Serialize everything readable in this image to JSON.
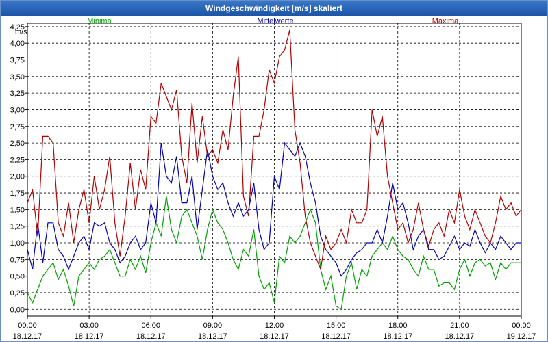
{
  "window": {
    "title": "Windgeschwindigkeit [m/s] skaliert"
  },
  "chart_data": {
    "type": "line",
    "title": "Windgeschwindigkeit [m/s] skaliert",
    "ylabel": "m/s",
    "ylim": [
      -0.1,
      4.3
    ],
    "yticks": [
      "0,00",
      "0,25",
      "0,50",
      "0,75",
      "1,00",
      "1,25",
      "1,50",
      "1,75",
      "2,00",
      "2,25",
      "2,50",
      "2,75",
      "3,00",
      "3,25",
      "3,50",
      "3,75",
      "4,00",
      "4,25"
    ],
    "xlim": [
      0,
      24
    ],
    "xticks": [
      {
        "time": "00:00",
        "date": "18.12.17"
      },
      {
        "time": "03:00",
        "date": "18.12.17"
      },
      {
        "time": "06:00",
        "date": "18.12.17"
      },
      {
        "time": "09:00",
        "date": "18.12.17"
      },
      {
        "time": "12:00",
        "date": "18.12.17"
      },
      {
        "time": "15:00",
        "date": "18.12.17"
      },
      {
        "time": "18:00",
        "date": "18.12.17"
      },
      {
        "time": "21:00",
        "date": "18.12.17"
      },
      {
        "time": "00:00",
        "date": "19.12.17"
      }
    ],
    "grid": true,
    "legend_position": "top",
    "series": [
      {
        "name": "Minima",
        "color": "#00a000",
        "x": [
          0,
          0.25,
          0.5,
          0.75,
          1,
          1.25,
          1.5,
          1.75,
          2,
          2.25,
          2.5,
          2.75,
          3,
          3.25,
          3.5,
          3.75,
          4,
          4.25,
          4.5,
          4.75,
          5,
          5.25,
          5.5,
          5.75,
          6,
          6.25,
          6.5,
          6.75,
          7,
          7.25,
          7.5,
          7.75,
          8,
          8.25,
          8.5,
          8.75,
          9,
          9.25,
          9.5,
          9.75,
          10,
          10.25,
          10.5,
          10.75,
          11,
          11.25,
          11.5,
          11.75,
          12,
          12.25,
          12.5,
          12.75,
          13,
          13.25,
          13.5,
          13.75,
          14,
          14.25,
          14.5,
          14.75,
          15,
          15.25,
          15.5,
          15.75,
          16,
          16.25,
          16.5,
          16.75,
          17,
          17.25,
          17.5,
          17.75,
          18,
          18.25,
          18.5,
          18.75,
          19,
          19.25,
          19.5,
          19.75,
          20,
          20.25,
          20.5,
          20.75,
          21,
          21.25,
          21.5,
          21.75,
          22,
          22.25,
          22.5,
          22.75,
          23,
          23.25,
          23.5,
          23.75,
          24
        ],
        "values": [
          0.25,
          0.1,
          0.3,
          0.5,
          0.6,
          0.7,
          0.45,
          0.6,
          0.35,
          0.05,
          0.5,
          0.6,
          0.7,
          0.6,
          0.75,
          0.8,
          0.9,
          0.7,
          0.5,
          0.5,
          0.75,
          0.6,
          0.8,
          0.55,
          1.0,
          1.3,
          1.1,
          1.7,
          1.2,
          1.0,
          1.4,
          1.5,
          1.3,
          1.1,
          0.75,
          1.2,
          1.5,
          1.3,
          1.2,
          1.0,
          0.75,
          0.6,
          0.9,
          0.8,
          1.2,
          0.5,
          0.3,
          0.4,
          0.1,
          0.8,
          0.7,
          1.1,
          1.0,
          1.1,
          1.3,
          1.5,
          1.3,
          0.6,
          0.3,
          0.5,
          0.05,
          0.0,
          0.5,
          0.7,
          0.3,
          0.6,
          0.5,
          0.8,
          0.9,
          1.0,
          0.9,
          1.1,
          0.9,
          0.8,
          0.75,
          0.6,
          0.5,
          0.8,
          0.6,
          0.6,
          0.35,
          0.4,
          0.4,
          0.3,
          0.6,
          0.75,
          0.5,
          0.7,
          0.75,
          0.65,
          0.7,
          0.45,
          0.7,
          0.6,
          0.7,
          0.7,
          0.7
        ]
      },
      {
        "name": "Mittelwerte",
        "color": "#0000b0",
        "x": [
          0,
          0.25,
          0.5,
          0.75,
          1,
          1.25,
          1.5,
          1.75,
          2,
          2.25,
          2.5,
          2.75,
          3,
          3.25,
          3.5,
          3.75,
          4,
          4.25,
          4.5,
          4.75,
          5,
          5.25,
          5.5,
          5.75,
          6,
          6.25,
          6.5,
          6.75,
          7,
          7.25,
          7.5,
          7.75,
          8,
          8.25,
          8.5,
          8.75,
          9,
          9.25,
          9.5,
          9.75,
          10,
          10.25,
          10.5,
          10.75,
          11,
          11.25,
          11.5,
          11.75,
          12,
          12.25,
          12.5,
          12.75,
          13,
          13.25,
          13.5,
          13.75,
          14,
          14.25,
          14.5,
          14.75,
          15,
          15.25,
          15.5,
          15.75,
          16,
          16.25,
          16.5,
          16.75,
          17,
          17.25,
          17.5,
          17.75,
          18,
          18.25,
          18.5,
          18.75,
          19,
          19.25,
          19.5,
          19.75,
          20,
          20.25,
          20.5,
          20.75,
          21,
          21.25,
          21.5,
          21.75,
          22,
          22.25,
          22.5,
          22.75,
          23,
          23.25,
          23.5,
          23.75,
          24
        ],
        "values": [
          0.9,
          0.6,
          1.3,
          0.7,
          1.3,
          1.3,
          0.9,
          0.8,
          0.6,
          0.8,
          1.0,
          1.1,
          0.9,
          1.3,
          1.25,
          1.3,
          1.0,
          0.9,
          0.7,
          0.8,
          1.0,
          1.1,
          0.9,
          1.0,
          1.6,
          1.3,
          2.5,
          2.0,
          1.9,
          2.3,
          1.6,
          1.6,
          2.0,
          1.2,
          1.8,
          2.4,
          2.0,
          1.8,
          1.9,
          1.6,
          1.4,
          1.6,
          1.4,
          1.5,
          1.9,
          1.2,
          0.9,
          1.0,
          2.0,
          1.8,
          2.5,
          2.4,
          2.3,
          2.5,
          2.3,
          1.9,
          1.6,
          1.1,
          0.9,
          0.8,
          0.7,
          0.5,
          0.6,
          0.75,
          0.85,
          0.9,
          1.0,
          1.0,
          1.2,
          1.0,
          1.4,
          1.9,
          1.5,
          1.6,
          1.3,
          0.9,
          1.1,
          1.2,
          0.9,
          0.9,
          0.75,
          0.8,
          0.95,
          1.1,
          0.9,
          1.0,
          0.95,
          1.2,
          1.0,
          0.85,
          1.0,
          0.9,
          1.1,
          1.0,
          0.9,
          1.0,
          1.0
        ]
      },
      {
        "name": "Maxima",
        "color": "#b00000",
        "x": [
          0,
          0.25,
          0.5,
          0.75,
          1,
          1.25,
          1.5,
          1.75,
          2,
          2.25,
          2.5,
          2.75,
          3,
          3.25,
          3.5,
          3.75,
          4,
          4.25,
          4.5,
          4.75,
          5,
          5.25,
          5.5,
          5.75,
          6,
          6.25,
          6.5,
          6.75,
          7,
          7.25,
          7.5,
          7.75,
          8,
          8.25,
          8.5,
          8.75,
          9,
          9.25,
          9.5,
          9.75,
          10,
          10.25,
          10.5,
          10.75,
          11,
          11.25,
          11.5,
          11.75,
          12,
          12.25,
          12.5,
          12.75,
          13,
          13.25,
          13.5,
          13.75,
          14,
          14.25,
          14.5,
          14.75,
          15,
          15.25,
          15.5,
          15.75,
          16,
          16.25,
          16.5,
          16.75,
          17,
          17.25,
          17.5,
          17.75,
          18,
          18.25,
          18.5,
          18.75,
          19,
          19.25,
          19.5,
          19.75,
          20,
          20.25,
          20.5,
          20.75,
          21,
          21.25,
          21.5,
          21.75,
          22,
          22.25,
          22.5,
          22.75,
          23,
          23.25,
          23.5,
          23.75,
          24
        ],
        "values": [
          1.6,
          1.8,
          1.1,
          2.6,
          2.6,
          2.5,
          1.3,
          1.1,
          1.6,
          1.0,
          1.5,
          1.8,
          1.3,
          2.0,
          1.5,
          1.8,
          2.3,
          1.3,
          0.8,
          1.4,
          2.2,
          1.5,
          2.1,
          1.8,
          2.9,
          2.8,
          3.4,
          3.2,
          3.0,
          3.3,
          2.3,
          1.9,
          3.1,
          2.2,
          2.9,
          2.3,
          2.4,
          2.2,
          2.7,
          2.4,
          3.2,
          3.8,
          1.7,
          1.4,
          2.6,
          2.6,
          3.0,
          3.6,
          3.4,
          3.8,
          3.9,
          4.2,
          2.7,
          2.2,
          1.4,
          1.0,
          0.8,
          0.6,
          1.1,
          0.9,
          1.0,
          1.2,
          1.0,
          1.5,
          1.3,
          1.3,
          1.5,
          3.0,
          2.6,
          2.9,
          2.0,
          1.6,
          1.2,
          1.3,
          1.0,
          1.2,
          1.6,
          1.2,
          0.95,
          1.2,
          1.3,
          1.1,
          1.5,
          1.3,
          1.8,
          1.4,
          1.2,
          1.5,
          1.3,
          1.1,
          1.0,
          1.3,
          1.7,
          1.5,
          1.6,
          1.4,
          1.5
        ]
      }
    ]
  }
}
